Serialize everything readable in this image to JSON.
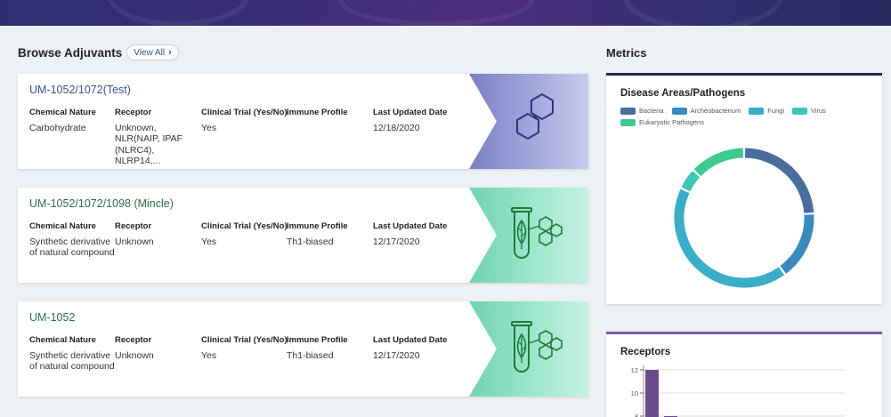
{
  "browse": {
    "title": "Browse Adjuvants",
    "view_all": "View All"
  },
  "columns": [
    "Chemical Nature",
    "Receptor",
    "Clinical Trial (Yes/No)",
    "Immune Profile",
    "Last Updated Date"
  ],
  "cards": [
    {
      "title": "UM-1052/1072(Test)",
      "title_color": "#3c4f8f",
      "art": "hexagons-icon",
      "values": [
        "Carbohydrate",
        "Unknown, NLR(NAIP, IPAF (NLRC4), NLRP14,...",
        "Yes",
        "",
        "12/18/2020"
      ]
    },
    {
      "title": "UM-1052/1072/1098 (Mincle)",
      "title_color": "#2d6f4a",
      "art": "test-tube-leaf-icon",
      "values": [
        "Synthetic derivative of natural compound",
        "Unknown",
        "Yes",
        "Th1-biased",
        "12/17/2020"
      ]
    },
    {
      "title": "UM-1052",
      "title_color": "#2d6f4a",
      "art": "test-tube-leaf-icon",
      "values": [
        "Synthetic derivative of natural compound",
        "Unknown",
        "Yes",
        "Th1-biased",
        "12/17/2020"
      ]
    }
  ],
  "metrics": {
    "title": "Metrics",
    "disease_panel": {
      "title": "Disease Areas/Pathogens",
      "accent": "#1f2a44",
      "legend": [
        {
          "label": "Bacteria",
          "color": "#4a6d9e"
        },
        {
          "label": "Archeobacterium",
          "color": "#3a8bbd"
        },
        {
          "label": "Fungi",
          "color": "#3aaec6"
        },
        {
          "label": "Virus",
          "color": "#3cc6b4"
        },
        {
          "label": "Eukaryotic Pathogens",
          "color": "#3dca8f"
        }
      ]
    },
    "receptors_panel": {
      "title": "Receptors",
      "accent": "#7a5aa8",
      "bar_color": "#6a4c8c"
    }
  },
  "chart_data": [
    {
      "type": "pie",
      "title": "Disease Areas/Pathogens",
      "categories": [
        "Bacteria",
        "Archeobacterium",
        "Fungi",
        "Virus",
        "Eukaryotic Pathogens"
      ],
      "values": [
        24,
        16,
        42,
        5,
        13
      ],
      "legend_position": "top"
    },
    {
      "type": "bar",
      "title": "Receptors",
      "values": [
        12,
        8
      ],
      "ylim": [
        0,
        12
      ],
      "yticks": [
        8,
        10,
        12
      ],
      "grid": true
    }
  ]
}
